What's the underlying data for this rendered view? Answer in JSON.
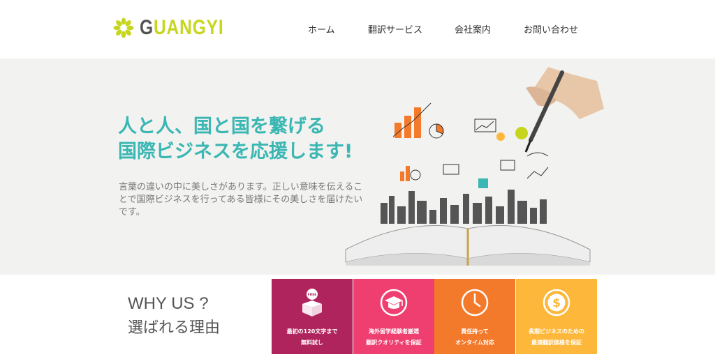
{
  "brand": {
    "logo_first": "G",
    "logo_rest": "UANGYI",
    "accent": "#c6d61f"
  },
  "nav": {
    "items": [
      "ホーム",
      "翻訳サービス",
      "会社案内",
      "お問い合わせ"
    ]
  },
  "hero": {
    "title_line1": "人と人、国と国を繋げる",
    "title_line2": "国際ビジネスを応援します!",
    "text": "言葉の違いの中に美しさがあります。正しい意味を伝えることで国際ビジネスを行ってある皆様にその美しさを届けたいです。",
    "title_color": "#3ab7b3"
  },
  "why": {
    "title_en": "WHY US ?",
    "title_jp": "選ばれる理由",
    "cards": [
      {
        "icon": "free-box-icon",
        "line1": "最初の120文字まで",
        "line2": "無料試し",
        "color": "#b0245d"
      },
      {
        "icon": "graduation-cap-icon",
        "line1": "海外留学経験者厳選",
        "line2": "翻訳クオリティを保証",
        "color": "#ee3f70"
      },
      {
        "icon": "clock-icon",
        "line1": "責任持って",
        "line2": "オンタイム対応",
        "color": "#f47a2b"
      },
      {
        "icon": "dollar-coin-icon",
        "line1": "長期ビジネスのための",
        "line2": "最適翻訳価格を保証",
        "color": "#fdb83c"
      }
    ]
  }
}
